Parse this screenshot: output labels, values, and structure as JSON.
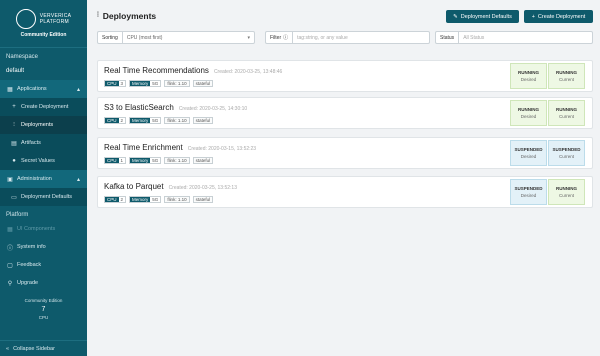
{
  "sidebar": {
    "brand_line1": "VERVERICA",
    "brand_line2": "PLATFORM",
    "edition": "Community Edition",
    "namespace_label": "Namespace",
    "namespace_value": "default",
    "applications": "Applications",
    "create_deployment": "Create Deployment",
    "deployments": "Deployments",
    "artifacts": "Artifacts",
    "secret_values": "Secret Values",
    "administration": "Administration",
    "deployment_defaults": "Deployment Defaults",
    "platform_label": "Platform",
    "ui_components": "UI Components",
    "system_info": "System info",
    "feedback": "Feedback",
    "upgrade": "Upgrade",
    "community_edition": "Community Edition",
    "cpu_count": "7",
    "cpu_label": "CPU",
    "collapse": "Collapse Sidebar"
  },
  "header": {
    "title": "Deployments",
    "btn_defaults": "Deployment Defaults",
    "btn_create": "Create Deployment"
  },
  "filters": {
    "sorting_label": "Sorting",
    "sorting_value": "CPU (most first)",
    "filter_label": "Filter",
    "filter_placeholder": "tag:string, or any value",
    "status_label": "Status",
    "status_placeholder": "All Status"
  },
  "deployments": [
    {
      "name": "Real Time Recommendations",
      "created": "Created: 2020-03-25, 13:48:46",
      "cpu": "3",
      "memory": "5G",
      "flink": "flink: 1.10",
      "extra": "stateful",
      "desired": "RUNNING",
      "current": "RUNNING"
    },
    {
      "name": "S3 to ElasticSearch",
      "created": "Created: 2020-03-25, 14:30:10",
      "cpu": "2",
      "memory": "5G",
      "flink": "flink: 1.10",
      "extra": "stateful",
      "desired": "RUNNING",
      "current": "RUNNING"
    },
    {
      "name": "Real Time Enrichment",
      "created": "Created: 2020-03-15, 13:52:23",
      "cpu": "1",
      "memory": "5G",
      "flink": "flink: 1.10",
      "extra": "stateful",
      "desired": "SUSPENDED",
      "current": "SUSPENDED"
    },
    {
      "name": "Kafka to Parquet",
      "created": "Created: 2020-03-25, 13:52:13",
      "cpu": "2",
      "memory": "5G",
      "flink": "flink: 1.10",
      "extra": "stateful",
      "desired": "SUSPENDED",
      "current": "RUNNING"
    }
  ],
  "labels": {
    "cpu": "CPU",
    "memory": "Memory",
    "desired": "Desired",
    "current": "Current"
  }
}
